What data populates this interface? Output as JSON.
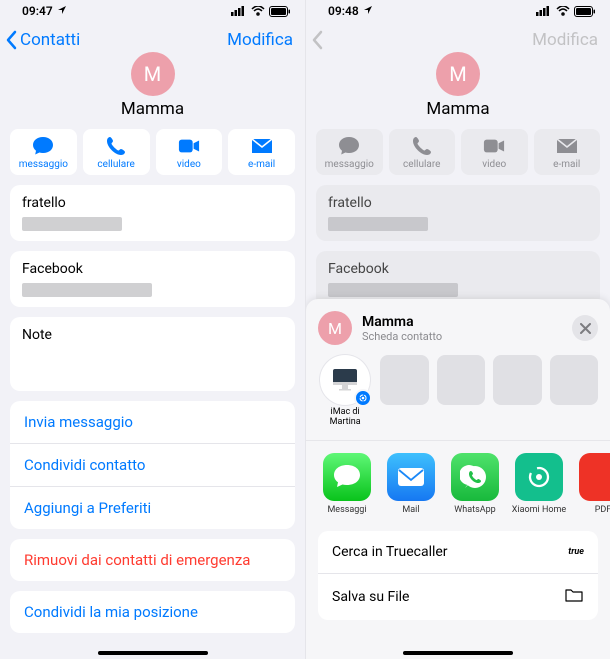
{
  "left": {
    "status_time": "09:47",
    "nav_back": "Contatti",
    "nav_edit": "Modifica",
    "avatar_initial": "M",
    "contact_name": "Mamma",
    "actions": {
      "message": "messaggio",
      "phone": "cellulare",
      "video": "video",
      "mail": "e-mail"
    },
    "fields": {
      "brother_label": "fratello",
      "facebook_label": "Facebook",
      "note_label": "Note"
    },
    "rows": {
      "send_message": "Invia messaggio",
      "share_contact": "Condividi contatto",
      "add_favorites": "Aggiungi a Preferiti",
      "remove_emergency": "Rimuovi dai contatti di emergenza",
      "share_location": "Condividi la mia posizione"
    }
  },
  "right": {
    "status_time": "09:48",
    "nav_back": "",
    "nav_edit": "Modifica",
    "avatar_initial": "M",
    "contact_name": "Mamma",
    "actions": {
      "message": "messaggio",
      "phone": "cellulare",
      "video": "video",
      "mail": "e-mail"
    },
    "fields": {
      "brother_label": "fratello",
      "facebook_label": "Facebook"
    },
    "sheet": {
      "title": "Mamma",
      "subtitle": "Scheda contatto",
      "airdrop_target": "iMac di Martina",
      "apps": {
        "messages": "Messaggi",
        "mail": "Mail",
        "whatsapp": "WhatsApp",
        "xiaomi": "Xiaomi Home",
        "pdf": "PDF"
      },
      "actions": {
        "truecaller": "Cerca in Truecaller",
        "save_files": "Salva su File",
        "true_badge": "true"
      }
    }
  }
}
